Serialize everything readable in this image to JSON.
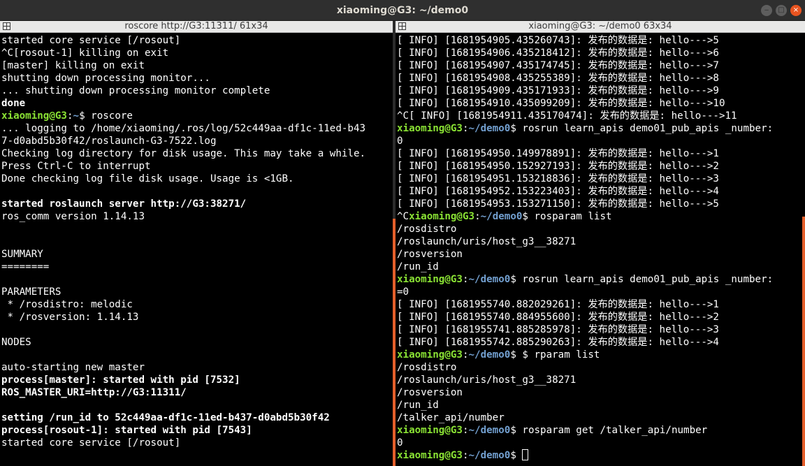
{
  "window": {
    "title": "xiaoming@G3: ~/demo0",
    "min_label": "‒",
    "max_label": "□",
    "close_label": "×"
  },
  "left_pane": {
    "title": "roscore http://G3:11311/ 61x34",
    "lines": [
      {
        "text": "started core service [/rosout]"
      },
      {
        "text": "^C[rosout-1] killing on exit"
      },
      {
        "text": "[master] killing on exit"
      },
      {
        "text": "shutting down processing monitor..."
      },
      {
        "text": "... shutting down processing monitor complete"
      },
      {
        "text": "done",
        "style": "bold"
      },
      {
        "user": "xiaoming@G3",
        "path": "~",
        "cmd": " roscore"
      },
      {
        "text": "... logging to /home/xiaoming/.ros/log/52c449aa-df1c-11ed-b43"
      },
      {
        "text": "7-d0abd5b30f42/roslaunch-G3-7522.log"
      },
      {
        "text": "Checking log directory for disk usage. This may take a while."
      },
      {
        "text": "Press Ctrl-C to interrupt"
      },
      {
        "text": "Done checking log file disk usage. Usage is <1GB."
      },
      {
        "text": ""
      },
      {
        "text": "started roslaunch server http://G3:38271/",
        "style": "bold"
      },
      {
        "text": "ros_comm version 1.14.13"
      },
      {
        "text": ""
      },
      {
        "text": ""
      },
      {
        "text": "SUMMARY"
      },
      {
        "text": "========"
      },
      {
        "text": ""
      },
      {
        "text": "PARAMETERS"
      },
      {
        "text": " * /rosdistro: melodic"
      },
      {
        "text": " * /rosversion: 1.14.13"
      },
      {
        "text": ""
      },
      {
        "text": "NODES"
      },
      {
        "text": ""
      },
      {
        "text": "auto-starting new master"
      },
      {
        "text": "process[master]: started with pid [7532]",
        "style": "bold"
      },
      {
        "text": "ROS_MASTER_URI=http://G3:11311/",
        "style": "bold"
      },
      {
        "text": ""
      },
      {
        "text": "setting /run_id to 52c449aa-df1c-11ed-b437-d0abd5b30f42",
        "style": "bold"
      },
      {
        "text": "process[rosout-1]: started with pid [7543]",
        "style": "bold"
      },
      {
        "text": "started core service [/rosout]"
      }
    ]
  },
  "right_pane": {
    "title": "xiaoming@G3: ~/demo0 63x34",
    "lines": [
      {
        "text": "[ INFO] [1681954905.435260743]: 发布的数据是: hello--->5"
      },
      {
        "text": "[ INFO] [1681954906.435218412]: 发布的数据是: hello--->6"
      },
      {
        "text": "[ INFO] [1681954907.435174745]: 发布的数据是: hello--->7"
      },
      {
        "text": "[ INFO] [1681954908.435255389]: 发布的数据是: hello--->8"
      },
      {
        "text": "[ INFO] [1681954909.435171933]: 发布的数据是: hello--->9"
      },
      {
        "text": "[ INFO] [1681954910.435099209]: 发布的数据是: hello--->10"
      },
      {
        "text": "^C[ INFO] [1681954911.435170474]: 发布的数据是: hello--->11"
      },
      {
        "user": "xiaoming@G3",
        "path": "~/demo0",
        "cmd": " rosrun learn_apis demo01_pub_apis _number:"
      },
      {
        "text": "0"
      },
      {
        "text": "[ INFO] [1681954950.149978891]: 发布的数据是: hello--->1"
      },
      {
        "text": "[ INFO] [1681954950.152927193]: 发布的数据是: hello--->2"
      },
      {
        "text": "[ INFO] [1681954951.153218836]: 发布的数据是: hello--->3"
      },
      {
        "text": "[ INFO] [1681954952.153223403]: 发布的数据是: hello--->4"
      },
      {
        "text": "[ INFO] [1681954953.153271150]: 发布的数据是: hello--->5"
      },
      {
        "pre": "^C",
        "user": "xiaoming@G3",
        "path": "~/demo0",
        "cmd": " rosparam list"
      },
      {
        "text": "/rosdistro"
      },
      {
        "text": "/roslaunch/uris/host_g3__38271"
      },
      {
        "text": "/rosversion"
      },
      {
        "text": "/run_id"
      },
      {
        "user": "xiaoming@G3",
        "path": "~/demo0",
        "cmd": " rosrun learn_apis demo01_pub_apis _number:"
      },
      {
        "text": "=0"
      },
      {
        "text": "[ INFO] [1681955740.882029261]: 发布的数据是: hello--->1"
      },
      {
        "text": "[ INFO] [1681955740.884955600]: 发布的数据是: hello--->2"
      },
      {
        "text": "[ INFO] [1681955741.885285978]: 发布的数据是: hello--->3"
      },
      {
        "text": "[ INFO] [1681955742.885290263]: 发布的数据是: hello--->4"
      },
      {
        "user": "xiaoming@G3",
        "path": "~/demo0",
        "cmd": " $ rparam list"
      },
      {
        "text": "/rosdistro"
      },
      {
        "text": "/roslaunch/uris/host_g3__38271"
      },
      {
        "text": "/rosversion"
      },
      {
        "text": "/run_id"
      },
      {
        "text": "/talker_api/number"
      },
      {
        "user": "xiaoming@G3",
        "path": "~/demo0",
        "cmd": " rosparam get /talker_api/number"
      },
      {
        "text": "0"
      },
      {
        "user": "xiaoming@G3",
        "path": "~/demo0",
        "cmd": " ",
        "cursor": true
      }
    ]
  },
  "colors": {
    "user_green": "#8ae234",
    "path_blue": "#729fcf",
    "accent_orange": "#e45f2b"
  },
  "icons": {
    "pane_menu": "grid-icon"
  }
}
